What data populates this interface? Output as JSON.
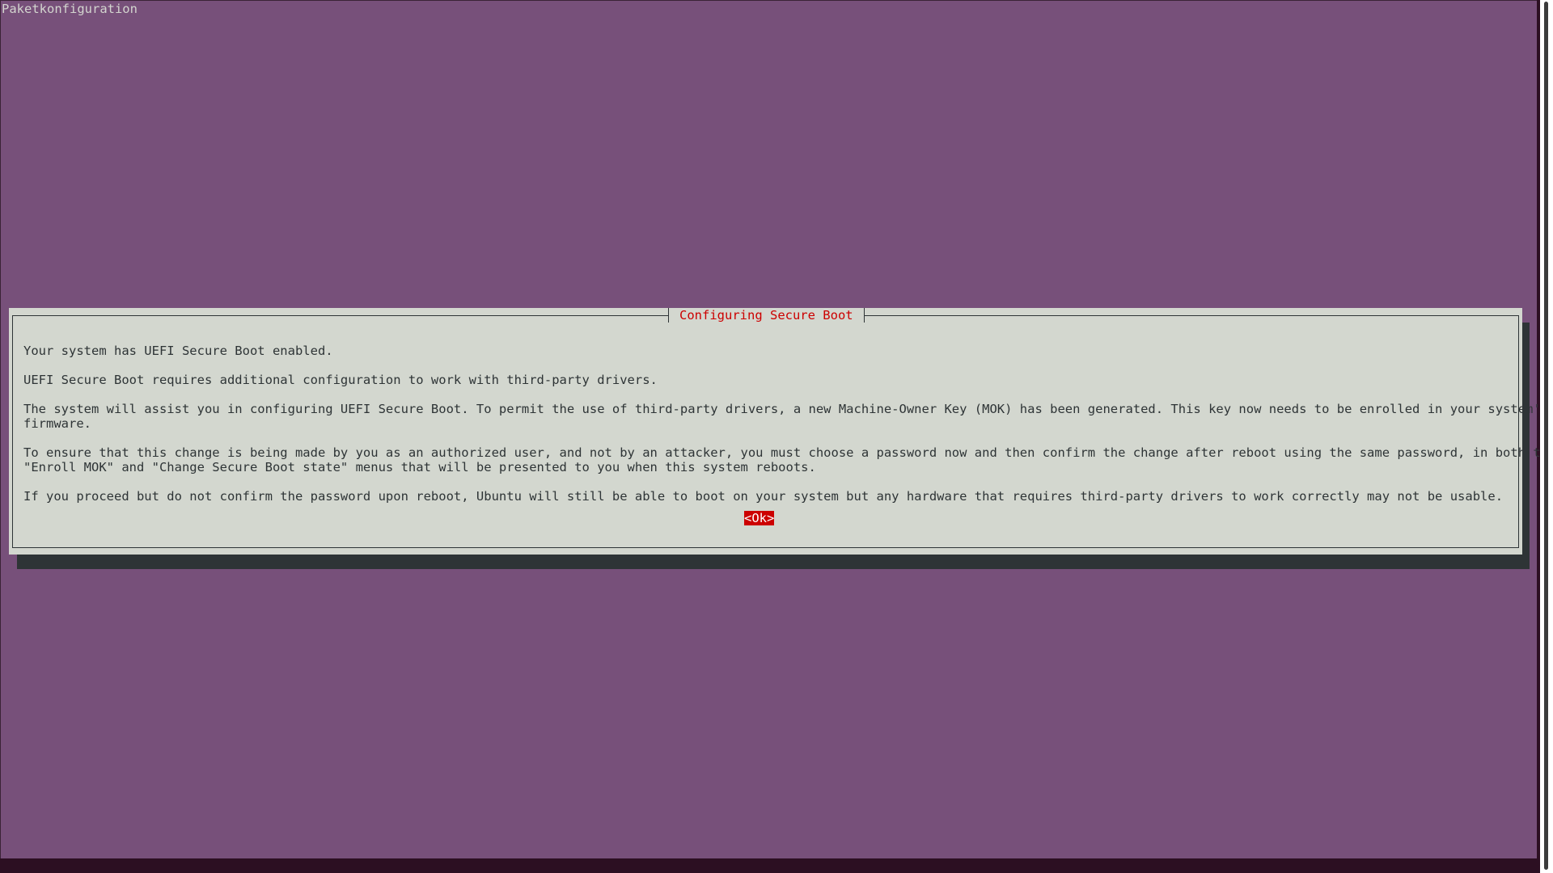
{
  "backtitle": "Paketkonfiguration",
  "dialog": {
    "title": "Configuring Secure Boot",
    "lines": [
      "Your system has UEFI Secure Boot enabled.",
      "UEFI Secure Boot requires additional configuration to work with third-party drivers.",
      "The system will assist you in configuring UEFI Secure Boot. To permit the use of third-party drivers, a new Machine-Owner Key (MOK) has been generated. This key now needs to be enrolled in your system's",
      "firmware.",
      "To ensure that this change is being made by you as an authorized user, and not by an attacker, you must choose a password now and then confirm the change after reboot using the same password, in both the",
      "\"Enroll MOK\" and \"Change Secure Boot state\" menus that will be presented to you when this system reboots.",
      "If you proceed but do not confirm the password upon reboot, Ubuntu will still be able to boot on your system but any hardware that requires third-party drivers to work correctly may not be usable."
    ],
    "ok_label": "<Ok>"
  },
  "colors": {
    "background": "#77507a",
    "dialog": "#d3d7cf",
    "accent": "#cc0000",
    "text": "#2e3436"
  }
}
